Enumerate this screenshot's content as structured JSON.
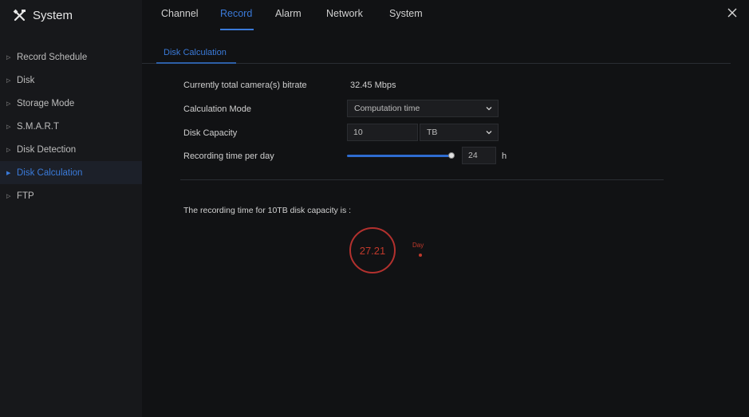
{
  "app": {
    "title": "System"
  },
  "sidebar": {
    "items": [
      {
        "label": "Record Schedule"
      },
      {
        "label": "Disk"
      },
      {
        "label": "Storage Mode"
      },
      {
        "label": "S.M.A.R.T"
      },
      {
        "label": "Disk Detection"
      },
      {
        "label": "Disk Calculation",
        "active": true
      },
      {
        "label": "FTP"
      }
    ]
  },
  "tabs": [
    {
      "label": "Channel"
    },
    {
      "label": "Record",
      "active": true
    },
    {
      "label": "Alarm"
    },
    {
      "label": "Network"
    },
    {
      "label": "System"
    }
  ],
  "subtab": {
    "label": "Disk Calculation"
  },
  "form": {
    "bitrate_label": "Currently total camera(s) bitrate",
    "bitrate_value": "32.45 Mbps",
    "mode_label": "Calculation Mode",
    "mode_value": "Computation time",
    "capacity_label": "Disk Capacity",
    "capacity_value": "10",
    "capacity_unit": "TB",
    "recording_label": "Recording time per day",
    "recording_value": "24",
    "recording_fraction": 1.0,
    "recording_unit": "h"
  },
  "result": {
    "text": "The recording time for 10TB disk capacity is :",
    "value": "27.21",
    "unit": "Day"
  },
  "colors": {
    "accent": "#3a7ad9",
    "result": "#c0392b",
    "background": "#111214",
    "sidebar": "#17181b"
  },
  "icons": {
    "brand": "tools-icon",
    "close": "close-icon",
    "dropdown": "chevron-down-icon",
    "bullet": "triangle-right-icon"
  }
}
